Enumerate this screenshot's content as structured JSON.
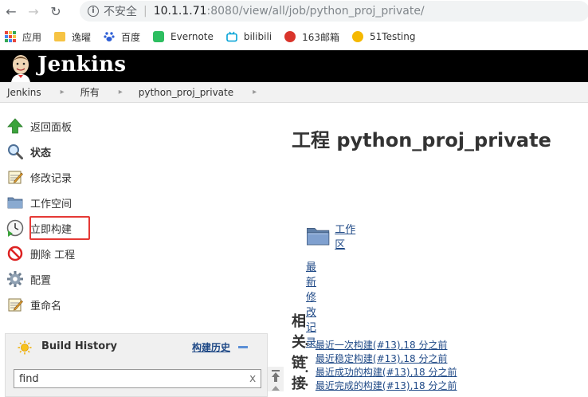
{
  "browser": {
    "insecure_label": "不安全",
    "separator": "|",
    "url_host": "10.1.1.71",
    "url_rest": ":8080/view/all/job/python_proj_private/"
  },
  "bookmarks": [
    {
      "label": "应用",
      "icon": "apps-grid-icon",
      "color": "#e8453c"
    },
    {
      "label": "逸曜",
      "icon": "folder-icon",
      "color": "#f6c343"
    },
    {
      "label": "百度",
      "icon": "baidu-paw-icon",
      "color": "#2e5fd6"
    },
    {
      "label": "Evernote",
      "icon": "evernote-icon",
      "color": "#2dbe60"
    },
    {
      "label": "bilibili",
      "icon": "bilibili-tv-icon",
      "color": "#00a1d6"
    },
    {
      "label": "163邮箱",
      "icon": "mail163-icon",
      "color": "#d9342b"
    },
    {
      "label": "51Testing",
      "icon": "testing51-icon",
      "color": "#f5b800"
    }
  ],
  "header": {
    "title": "Jenkins"
  },
  "breadcrumb": [
    "Jenkins",
    "所有",
    "python_proj_private"
  ],
  "side_tasks": [
    {
      "label": "返回面板",
      "icon": "up-arrow-icon",
      "bold": false
    },
    {
      "label": "状态",
      "icon": "magnifier-icon",
      "bold": true
    },
    {
      "label": "修改记录",
      "icon": "notepad-icon",
      "bold": false
    },
    {
      "label": "工作空间",
      "icon": "folder-icon",
      "bold": false
    },
    {
      "label": "立即构建",
      "icon": "clock-build-icon",
      "bold": false
    },
    {
      "label": "删除 工程",
      "icon": "no-entry-icon",
      "bold": false
    },
    {
      "label": "配置",
      "icon": "gear-icon",
      "bold": false
    },
    {
      "label": "重命名",
      "icon": "notepad-icon",
      "bold": false
    }
  ],
  "build_history": {
    "title": "Build History",
    "trend_link": "构建历史",
    "search_value": "find",
    "clear_symbol": "x"
  },
  "main": {
    "title": "工程 python_proj_private",
    "workspace_link": "工作区",
    "changes_link": "最新修改记录",
    "related_heading": "相关链接",
    "permalinks": [
      "最近一次构建(#13),18 分之前",
      "最近稳定构建(#13),18 分之前",
      "最近成功的构建(#13),18 分之前",
      "最近完成的构建(#13),18 分之前"
    ]
  },
  "colors": {
    "link": "#204a87",
    "header_bg": "#000000",
    "highlight": "#e53935"
  }
}
